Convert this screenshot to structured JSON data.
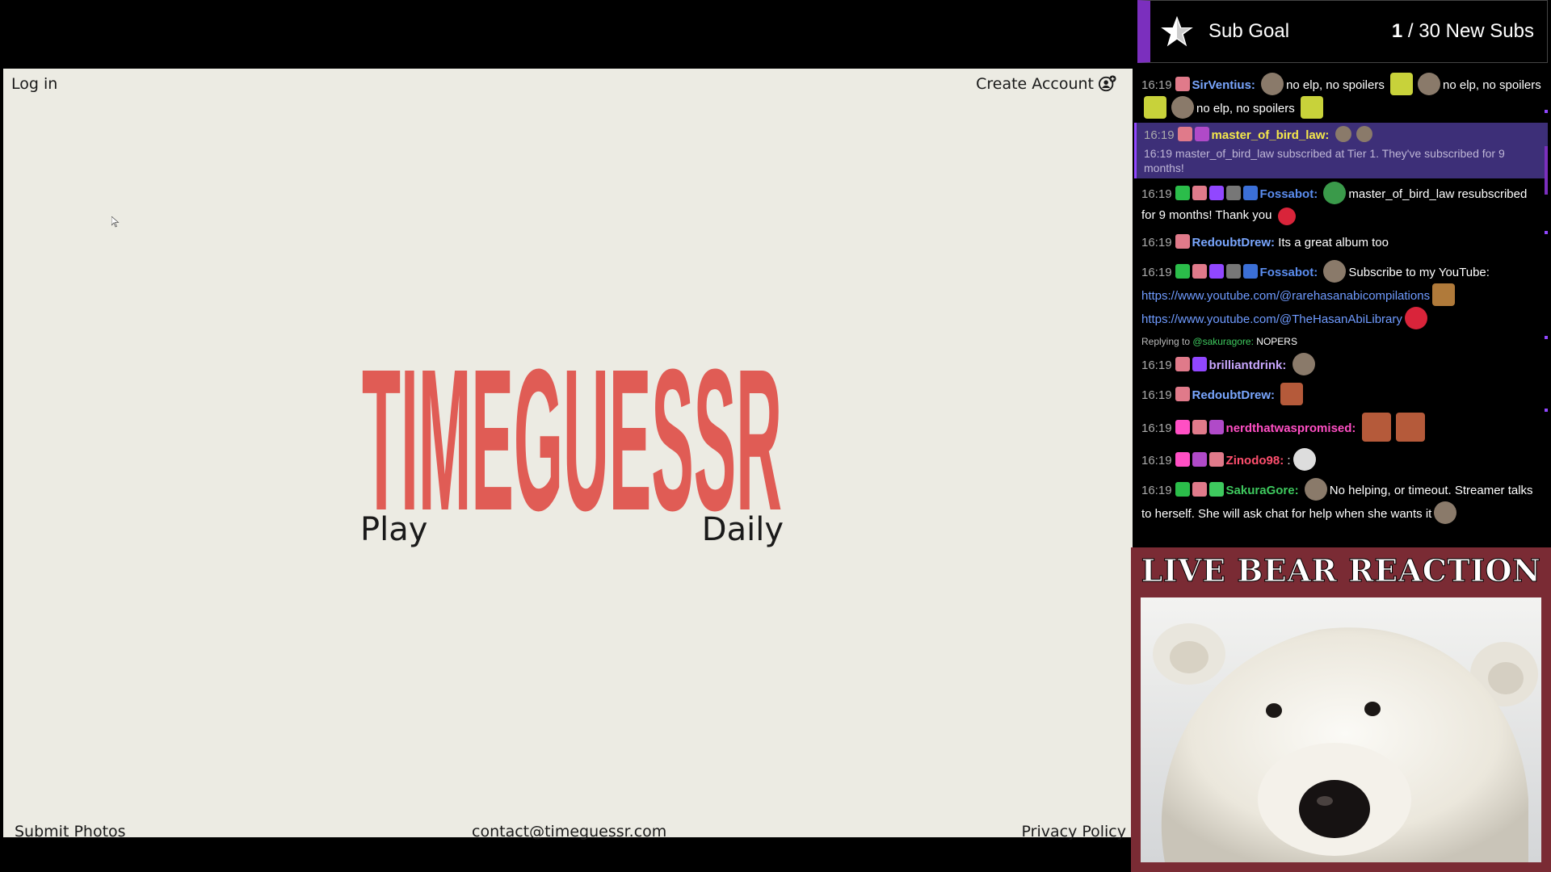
{
  "game": {
    "login": "Log in",
    "create_account": "Create Account",
    "logo_text": "TIMEGUESSR",
    "play": "Play",
    "daily": "Daily",
    "footer": {
      "submit": "Submit Photos",
      "contact": "contact@timeguessr.com",
      "privacy": "Privacy Policy"
    },
    "colors": {
      "background": "#ecebe3",
      "logo": "#e05c55"
    }
  },
  "subgoal": {
    "title": "Sub Goal",
    "current": "1",
    "target": " / 30 New Subs",
    "accent": "#7b2fbe"
  },
  "chat": {
    "messages": [
      {
        "time": "16:19",
        "user": "SirVentius:",
        "text1": "no elp, no spoilers",
        "text2": "no elp, no spoilers",
        "text3": "no elp, no spoilers",
        "color": "#7aa7ff"
      },
      {
        "time": "16:19",
        "user": "master_of_bird_law:",
        "system": "16:19 master_of_bird_law subscribed at Tier 1. They've subscribed for 9 months!",
        "color": "#f5e84a"
      },
      {
        "time": "16:19",
        "user": "Fossabot:",
        "text": "master_of_bird_law resubscribed for 9 months! Thank you",
        "color": "#5b8def"
      },
      {
        "time": "16:19",
        "user": "RedoubtDrew:",
        "text": "Its a great album too",
        "color": "#7aa7ff"
      },
      {
        "time": "16:19",
        "user": "Fossabot:",
        "text": "Subscribe to my YouTube:",
        "link1": "https://www.youtube.com/@rarehasanabicompilations",
        "link2": "https://www.youtube.com/@TheHasanAbiLibrary",
        "color": "#5b8def"
      },
      {
        "reply_label": "Replying to",
        "reply_user": "@sakuragore:",
        "reply_text": "NOPERS"
      },
      {
        "time": "16:19",
        "user": "brilliantdrink:",
        "color": "#c9a7ff"
      },
      {
        "time": "16:19",
        "user": "RedoubtDrew:",
        "color": "#7aa7ff"
      },
      {
        "time": "16:19",
        "user": "nerdthatwaspromised:",
        "color": "#ff4fc4"
      },
      {
        "time": "16:19",
        "user": "Zinodo98:",
        "text": ":",
        "color": "#ff4f6e"
      },
      {
        "time": "16:19",
        "user": "SakuraGore:",
        "text": "No helping, or timeout. Streamer talks to herself. She will ask chat for help when she wants it",
        "color": "#3ec95e"
      }
    ]
  },
  "bear": {
    "title": "LIVE BEAR REACTION",
    "frame_color": "#7a2b34"
  }
}
